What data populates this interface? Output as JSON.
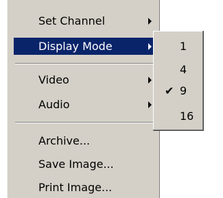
{
  "menu": {
    "items": [
      {
        "label": "Set Channel",
        "has_submenu": true
      },
      {
        "label": "Display Mode",
        "has_submenu": true,
        "highlighted": true
      },
      {
        "label": "Video",
        "has_submenu": true
      },
      {
        "label": "Audio",
        "has_submenu": true
      },
      {
        "label": "Archive..."
      },
      {
        "label": "Save Image..."
      },
      {
        "label": "Print Image..."
      }
    ]
  },
  "submenu": {
    "items": [
      {
        "label": "1",
        "checked": false
      },
      {
        "label": "4",
        "checked": false
      },
      {
        "label": "9",
        "checked": true
      },
      {
        "label": "16",
        "checked": false
      }
    ],
    "check_glyph": "✔"
  },
  "colors": {
    "menu_bg": "#d4d0c8",
    "highlight_bg": "#0a246a",
    "highlight_text": "#ffffff"
  }
}
